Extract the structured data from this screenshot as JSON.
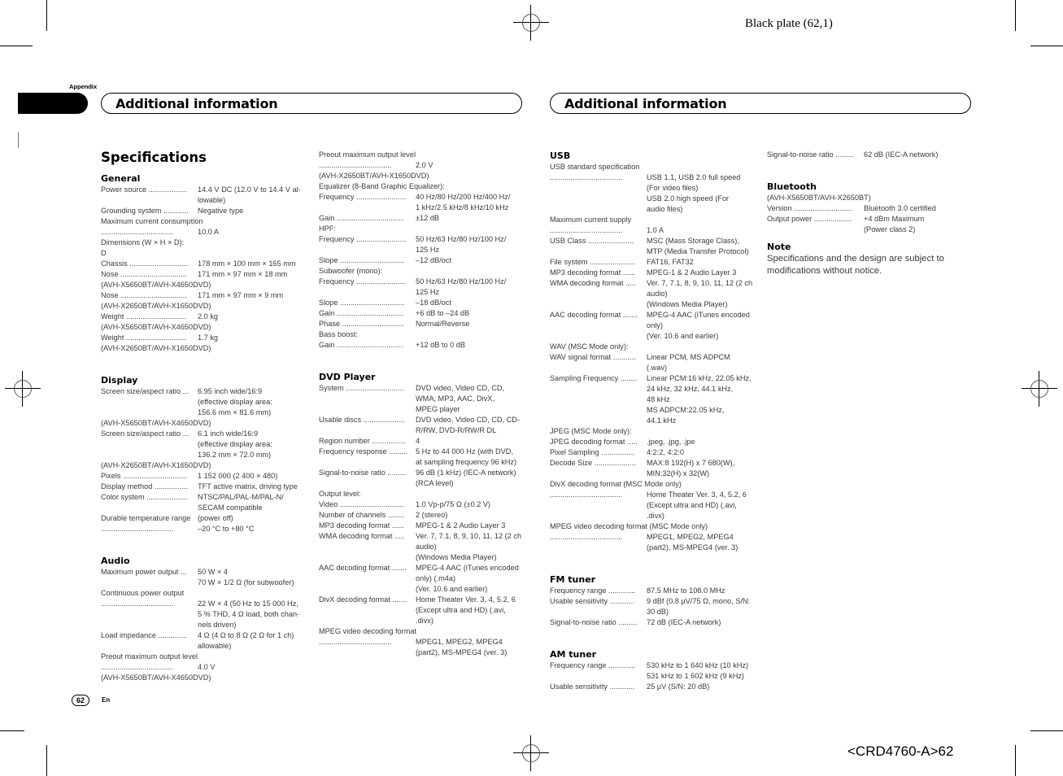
{
  "print_marks": {
    "plate": "Black plate (62,1)",
    "code": "<CRD4760-A>62"
  },
  "header": {
    "section_tab": "Appendix",
    "left_title": "Additional information",
    "right_title": "Additional information"
  },
  "page_title": "Specifications",
  "footer": {
    "page_number": "62",
    "language": "En"
  },
  "col1": {
    "general": {
      "heading": "General",
      "rows": [
        {
          "label": "Power source ..................",
          "value": "14.4 V DC (12.0 V to 14.4 V al-\nlowable)"
        },
        {
          "label": "Grounding system ............",
          "value": "Negative type"
        },
        {
          "label": "Maximum current consumption",
          "value": "",
          "full": true
        },
        {
          "label": "        ...................................",
          "value": "10.0 A"
        },
        {
          "label": "Dimensions (W × H × D):",
          "value": "",
          "full": true
        },
        {
          "label": "D",
          "value": "",
          "full": true
        },
        {
          "label": "Chassis ............................",
          "value": "178 mm × 100 mm × 165 mm"
        },
        {
          "label": "Nose ................................",
          "value": "171 mm × 97 mm × 18 mm"
        },
        {
          "label": "(AVH-X5650BT/AVH-X4650DVD)",
          "value": "",
          "full": true
        },
        {
          "label": "Nose ................................",
          "value": "171 mm × 97 mm × 9 mm"
        },
        {
          "label": "(AVH-X2650BT/AVH-X1650DVD)",
          "value": "",
          "full": true
        },
        {
          "label": "Weight .............................",
          "value": "2.0 kg"
        },
        {
          "label": "(AVH-X5650BT/AVH-X4650DVD)",
          "value": "",
          "full": true
        },
        {
          "label": "Weight .............................",
          "value": "1.7 kg"
        },
        {
          "label": "(AVH-X2650BT/AVH-X1650DVD)",
          "value": "",
          "full": true
        }
      ]
    },
    "display": {
      "heading": "Display",
      "rows": [
        {
          "label": "Screen size/aspect ratio ...",
          "value": "6.95 inch wide/16:9\n(effective display area:\n156.6 mm × 81.6 mm)"
        },
        {
          "label": "(AVH-X5650BT/AVH-X4650DVD)",
          "value": "",
          "full": true
        },
        {
          "label": "Screen size/aspect ratio ...",
          "value": "6.1 inch wide/16:9\n(effective display area:\n136.2 mm × 72.0 mm)"
        },
        {
          "label": "(AVH-X2650BT/AVH-X1650DVD)",
          "value": "",
          "full": true
        },
        {
          "label": "Pixels ...............................",
          "value": "1 152 000 (2 400 × 480)"
        },
        {
          "label": "Display method ................",
          "value": "TFT active matrix, driving type"
        },
        {
          "label": "Color system ....................",
          "value": "NTSC/PAL/PAL-M/PAL-N/\nSECAM compatible"
        },
        {
          "label": "Durable temperature range",
          "value": "(power off)"
        },
        {
          "label": "        ...................................",
          "value": "–20 °C to +80 °C"
        }
      ]
    },
    "audio": {
      "heading": "Audio",
      "rows": [
        {
          "label": "Maximum power output ...",
          "value": "50 W × 4\n70 W × 1/2 Ω (for subwoofer)"
        },
        {
          "label": "Continuous power output",
          "value": "",
          "full": true
        },
        {
          "label": "        ...................................",
          "value": "22 W × 4 (50 Hz to 15 000 Hz,\n5 % THD, 4 Ω load, both chan-\nnels driven)"
        },
        {
          "label": "Load impedance ..............",
          "value": "4 Ω (4 Ω to 8 Ω (2 Ω for 1 ch)\nallowable)"
        },
        {
          "label": "Preout maximum output level",
          "value": "",
          "full": true
        },
        {
          "label": "        ...................................",
          "value": "4.0 V"
        },
        {
          "label": "(AVH-X5650BT/AVH-X4650DVD)",
          "value": "",
          "full": true
        }
      ]
    }
  },
  "col2": {
    "audio_cont": {
      "rows": [
        {
          "label": "Preout maximum output level",
          "value": "",
          "full": true
        },
        {
          "label": "        ...................................",
          "value": "2.0 V"
        },
        {
          "label": "(AVH-X2650BT/AVH-X1650DVD)",
          "value": "",
          "full": true
        },
        {
          "label": "Equalizer (8-Band Graphic Equalizer):",
          "value": "",
          "full": true
        },
        {
          "label": "Frequency ........................",
          "value": "40 Hz/80 Hz/200 Hz/400 Hz/\n1 kHz/2.5 kHz/8 kHz/10 kHz"
        },
        {
          "label": "Gain ................................",
          "value": "±12 dB"
        },
        {
          "label": "HPF:",
          "value": "",
          "full": true
        },
        {
          "label": "Frequency ........................",
          "value": "50 Hz/63 Hz/80 Hz/100 Hz/\n125 Hz"
        },
        {
          "label": "Slope ...............................",
          "value": "–12 dB/oct"
        },
        {
          "label": "Subwoofer (mono):",
          "value": "",
          "full": true
        },
        {
          "label": "Frequency ........................",
          "value": "50 Hz/63 Hz/80 Hz/100 Hz/\n125 Hz"
        },
        {
          "label": "Slope ...............................",
          "value": "–18 dB/oct"
        },
        {
          "label": "Gain ................................",
          "value": "+6 dB to –24 dB"
        },
        {
          "label": "Phase ..............................",
          "value": "Normal/Reverse"
        },
        {
          "label": "Bass boost:",
          "value": "",
          "full": true
        },
        {
          "label": "Gain ................................",
          "value": "+12 dB to 0 dB"
        }
      ]
    },
    "dvd": {
      "heading": "DVD Player",
      "rows": [
        {
          "label": "System ............................",
          "value": "DVD video, Video CD, CD,\nWMA, MP3, AAC, DivX,\nMPEG player"
        },
        {
          "label": "Usable discs ....................",
          "value": "DVD video, Video CD, CD, CD-\nR/RW, DVD-R/RW/R DL"
        },
        {
          "label": "Region number ................",
          "value": "4"
        },
        {
          "label": "Frequency response .........",
          "value": "5 Hz to 44 000 Hz (with DVD,\nat sampling frequency 96 kHz)"
        },
        {
          "label": "Signal-to-noise ratio .........",
          "value": "96 dB (1 kHz) (IEC-A network)\n(RCA level)"
        },
        {
          "label": "Output level:",
          "value": "",
          "full": true
        },
        {
          "label": "Video ...............................",
          "value": "1.0 Vp-p/75 Ω (±0.2 V)"
        },
        {
          "label": "Number of channels ........",
          "value": "2 (stereo)"
        },
        {
          "label": "MP3 decoding format ......",
          "value": "MPEG-1 & 2 Audio Layer 3"
        },
        {
          "label": "WMA decoding format .....",
          "value": "Ver. 7, 7.1, 8, 9, 10, 11, 12 (2 ch\naudio)\n(Windows Media Player)"
        },
        {
          "label": "AAC decoding format .......",
          "value": "MPEG-4 AAC (iTunes encoded\nonly) (.m4a)\n(Ver. 10.6 and earlier)"
        },
        {
          "label": "DivX decoding format .......",
          "value": "Home Theater Ver. 3, 4, 5.2, 6\n(Except ultra and HD) (.avi,\n.divx)"
        },
        {
          "label": "MPEG video decoding format",
          "value": "",
          "full": true
        },
        {
          "label": "        ...................................",
          "value": "MPEG1, MPEG2, MPEG4\n(part2), MS-MPEG4 (ver. 3)"
        }
      ]
    }
  },
  "col3": {
    "usb": {
      "heading": "USB",
      "rows": [
        {
          "label": "USB standard specification",
          "value": "",
          "full": true
        },
        {
          "label": "        ...................................",
          "value": "USB 1.1, USB 2.0 full speed\n(For video files)\nUSB 2.0 high speed (For\naudio files)"
        },
        {
          "label": "Maximum current supply",
          "value": "",
          "full": true
        },
        {
          "label": "        ...................................",
          "value": "1.0 A"
        },
        {
          "label": "USB Class ......................",
          "value": "MSC (Mass Storage Class),\nMTP (Media Transfer Protocol)"
        },
        {
          "label": "File system ......................",
          "value": "FAT16, FAT32"
        },
        {
          "label": "MP3 decoding format ......",
          "value": "MPEG-1 & 2 Audio Layer 3"
        },
        {
          "label": "WMA decoding format .....",
          "value": "Ver. 7, 7.1, 8, 9, 10, 11, 12 (2 ch\naudio)\n(Windows Media Player)"
        },
        {
          "label": "AAC decoding format .......",
          "value": "MPEG-4 AAC (iTunes encoded\nonly)\n(Ver. 10.6 and earlier)"
        },
        {
          "label": "WAV (MSC Mode only):",
          "value": "",
          "full": true
        },
        {
          "label": "WAV signal format ...........",
          "value": "Linear PCM, MS ADPCM\n(.wav)"
        },
        {
          "label": "Sampling Frequency ........",
          "value": "Linear PCM:16 kHz, 22.05 kHz,\n24 kHz, 32 kHz, 44.1 kHz,\n48 kHz\nMS ADPCM:22.05 kHz,\n44.1 kHz"
        },
        {
          "label": "JPEG (MSC Mode only):",
          "value": "",
          "full": true
        },
        {
          "label": "JPEG decoding format .....",
          "value": ".jpeg, .jpg, .jpe"
        },
        {
          "label": "Pixel Sampling ................",
          "value": "4:2:2, 4:2:0"
        },
        {
          "label": "Decode Size ....................",
          "value": "MAX:8 192(H) x 7 680(W),\nMIN:32(H) x 32(W)"
        },
        {
          "label": "DivX decoding format (MSC Mode only)",
          "value": "",
          "full": true
        },
        {
          "label": "        ...................................",
          "value": "Home Theater Ver. 3, 4, 5.2, 6\n(Except ultra and HD) (.avi,\n.divx)"
        },
        {
          "label": "MPEG video decoding format (MSC Mode only)",
          "value": "",
          "full": true
        },
        {
          "label": "        ...................................",
          "value": "MPEG1, MPEG2, MPEG4\n(part2), MS-MPEG4 (ver. 3)"
        }
      ]
    },
    "fm": {
      "heading": "FM tuner",
      "rows": [
        {
          "label": "Frequency range .............",
          "value": "87.5 MHz to 108.0 MHz"
        },
        {
          "label": "Usable sensitivity ............",
          "value": "9 dBf (0.8 µV/75 Ω, mono, S/N:\n30 dB)"
        },
        {
          "label": "Signal-to-noise ratio .........",
          "value": "72 dB (IEC-A network)"
        }
      ]
    },
    "am": {
      "heading": "AM tuner",
      "rows": [
        {
          "label": "Frequency range .............",
          "value": "530 kHz to 1 640 kHz (10 kHz)\n531 kHz to 1 602 kHz (9 kHz)"
        },
        {
          "label": "Usable sensitivity ............",
          "value": "25 µV (S/N: 20 dB)"
        }
      ]
    }
  },
  "col4": {
    "am_cont": {
      "rows": [
        {
          "label": "Signal-to-noise ratio .........",
          "value": "62 dB (IEC-A network)"
        }
      ]
    },
    "bluetooth": {
      "heading": "Bluetooth",
      "rows": [
        {
          "label": "(AVH-X5650BT/AVH-X2650BT)",
          "value": "",
          "full": true
        },
        {
          "label": "Version ............................",
          "value": "Bluetooth 3.0 certified"
        },
        {
          "label": "Output power ..................",
          "value": "+4 dBm Maximum\n(Power class 2)"
        }
      ]
    },
    "note": {
      "heading": "Note",
      "text": "Specifications and the design are subject to modifications without notice."
    }
  }
}
